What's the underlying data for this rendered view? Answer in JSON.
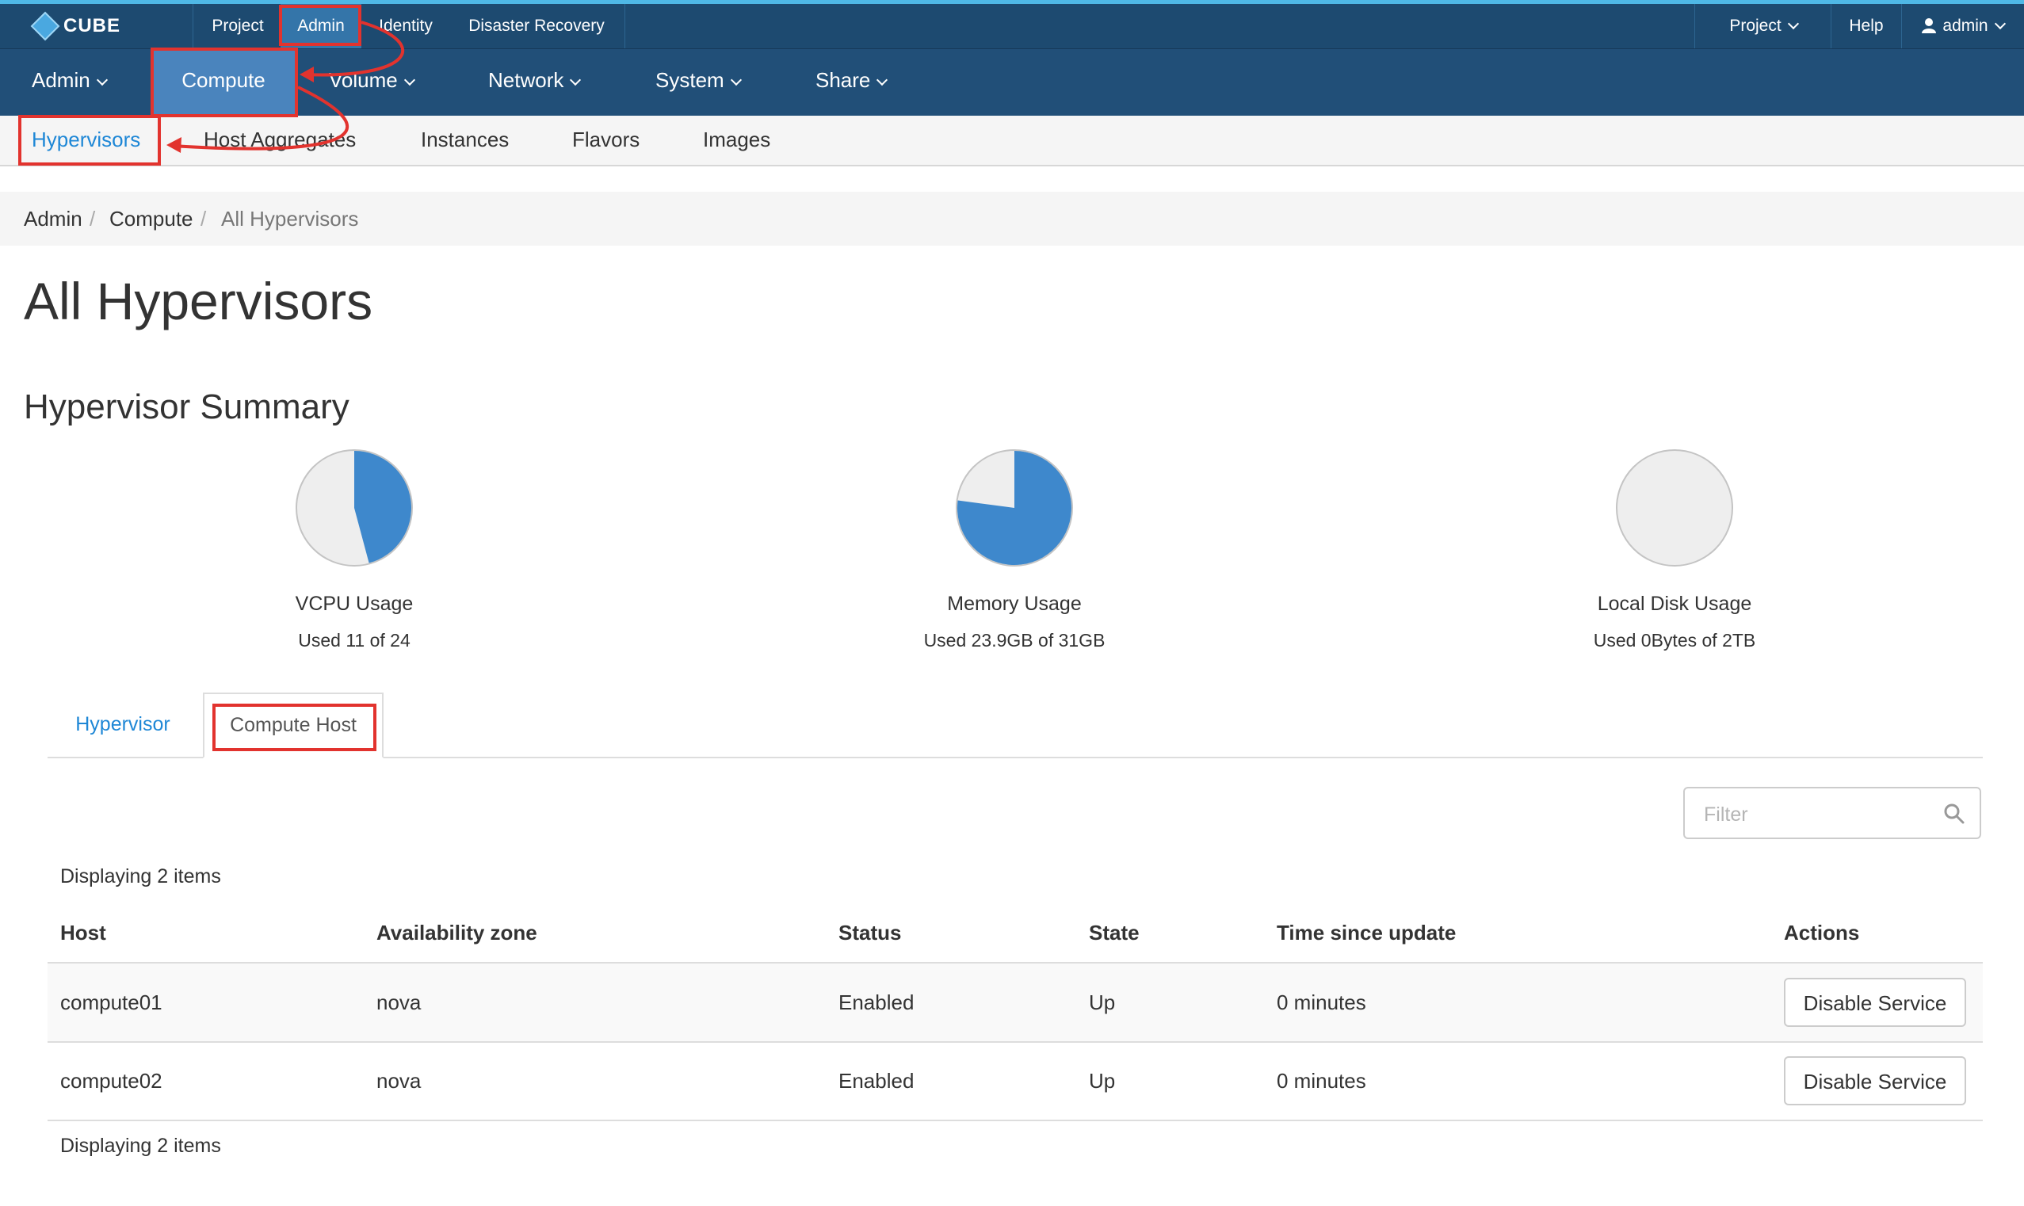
{
  "topbar": {
    "brand": "CUBE",
    "links": [
      "Project",
      "Admin",
      "Identity",
      "Disaster Recovery"
    ],
    "right": {
      "project": "Project",
      "help": "Help",
      "user": "admin"
    }
  },
  "secondary_nav": [
    "Admin",
    "Compute",
    "Volume",
    "Network",
    "System",
    "Share"
  ],
  "compute_nav": [
    "Hypervisors",
    "Host Aggregates",
    "Instances",
    "Flavors",
    "Images"
  ],
  "breadcrumb": [
    "Admin",
    "Compute",
    "All Hypervisors"
  ],
  "breadcrumb_separator": "/",
  "page_title": "All Hypervisors",
  "summary": {
    "title": "Hypervisor Summary",
    "charts": [
      {
        "label": "VCPU Usage",
        "detail": "Used 11 of 24",
        "used": 11,
        "total": 24
      },
      {
        "label": "Memory Usage",
        "detail": "Used 23.9GB of 31GB",
        "used": 23.9,
        "total": 31
      },
      {
        "label": "Local Disk Usage",
        "detail": "Used 0Bytes of 2TB",
        "used": 0,
        "total": 2
      }
    ]
  },
  "tabs": [
    "Hypervisor",
    "Compute Host"
  ],
  "filter": {
    "placeholder": "Filter"
  },
  "displaying": "Displaying 2 items",
  "table": {
    "columns": [
      "Host",
      "Availability zone",
      "Status",
      "State",
      "Time since update",
      "Actions"
    ],
    "rows": [
      {
        "host": "compute01",
        "zone": "nova",
        "status": "Enabled",
        "state": "Up",
        "updated": "0 minutes",
        "action": "Disable Service"
      },
      {
        "host": "compute02",
        "zone": "nova",
        "status": "Enabled",
        "state": "Up",
        "updated": "0 minutes",
        "action": "Disable Service"
      }
    ]
  },
  "colors": {
    "topbar": "#1d4a70",
    "secondary_nav": "#214f78",
    "active_nav": "#4a84bd",
    "accent": "#1e87d6",
    "pie_used": "#3e88cc",
    "pie_free": "#eeeeee",
    "annotation": "#e2332e"
  },
  "icons": [
    "cube-logo-icon",
    "user-icon",
    "chevron-down-icon",
    "search-icon"
  ]
}
